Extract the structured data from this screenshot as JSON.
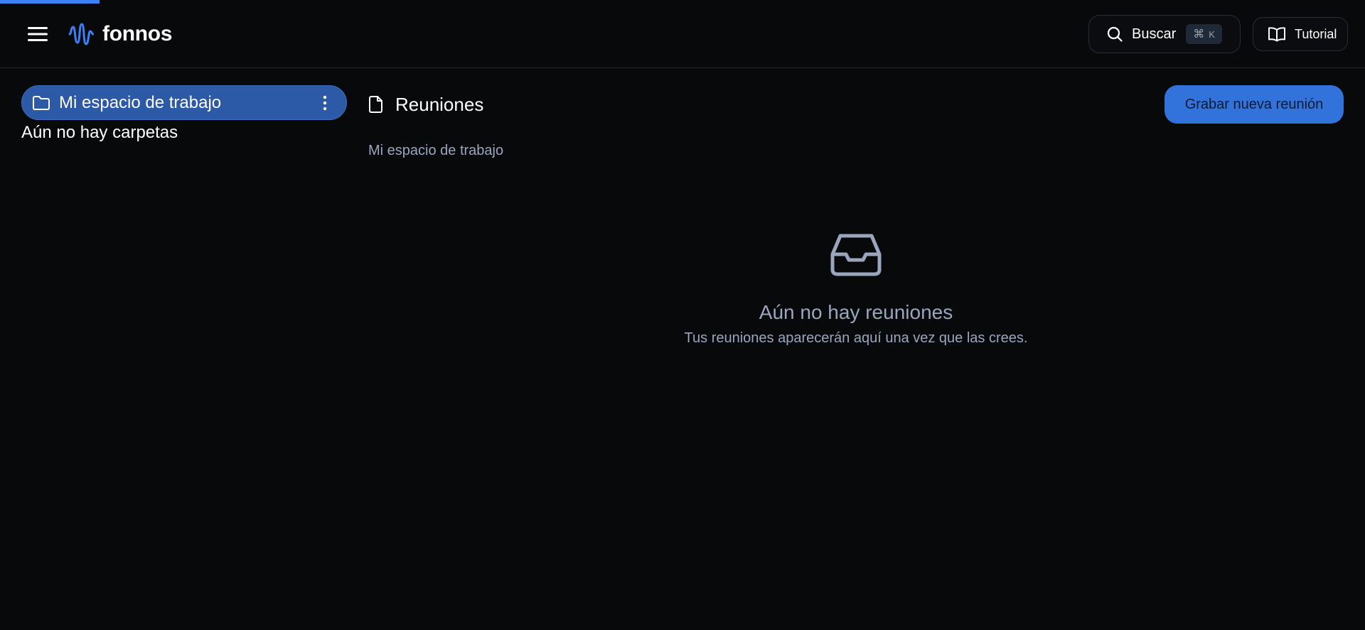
{
  "header": {
    "brand": "fonnos",
    "search_label": "Buscar",
    "search_shortcut_symbol": "⌘",
    "search_shortcut_key": "K",
    "tutorial_label": "Tutorial"
  },
  "sidebar": {
    "workspace_label": "Mi espacio de trabajo",
    "empty_folders_text": "Aún no hay carpetas"
  },
  "main": {
    "title": "Reuniones",
    "breadcrumb": "Mi espacio de trabajo",
    "record_button_label": "Grabar nueva reunión",
    "empty_state": {
      "icon": "inbox-icon",
      "title": "Aún no hay reuniones",
      "subtitle": "Tus reuniones aparecerán aquí una vez que las crees."
    }
  },
  "colors": {
    "background": "#08090b",
    "accent": "#3173db",
    "workspace_active": "#2d5aa6",
    "muted_text": "#9aa6bd"
  }
}
